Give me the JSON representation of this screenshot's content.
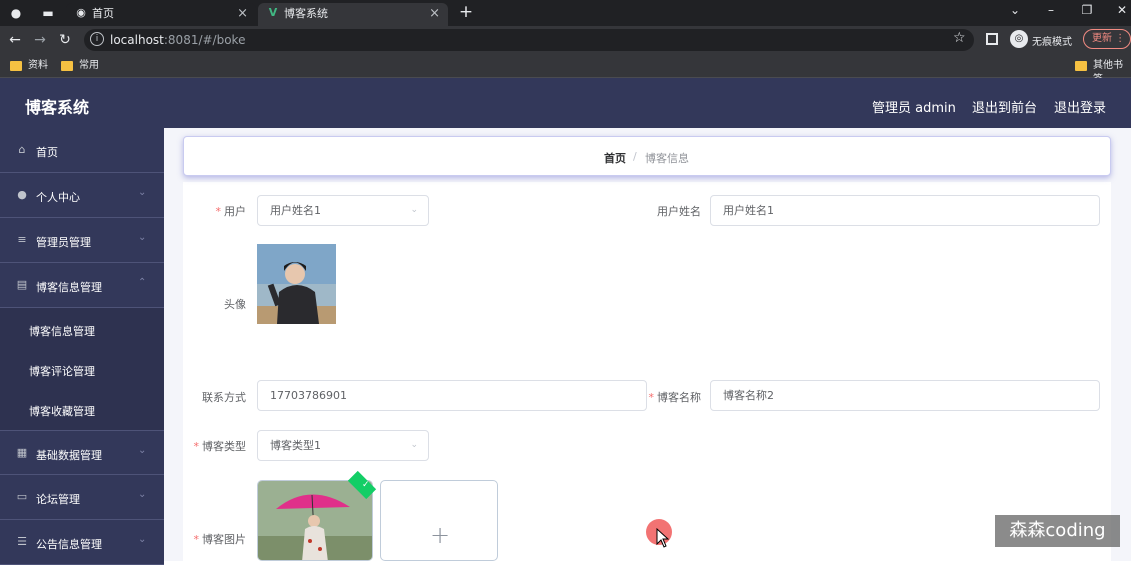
{
  "browser": {
    "tabs": [
      {
        "label": "首页",
        "close": "×"
      },
      {
        "label": "博客系统",
        "close": "×"
      }
    ],
    "new_tab": "+",
    "url_host": "localhost",
    "url_rest": ":8081/#/boke",
    "incognito_label": "无痕模式",
    "update_label": "更新",
    "bookmarks": [
      "资料",
      "常用"
    ],
    "other_bookmarks": "其他书签"
  },
  "header": {
    "title": "博客系统",
    "admin_label": "管理员 admin",
    "to_front_label": "退出到前台",
    "logout_label": "退出登录"
  },
  "sidebar": {
    "items": [
      {
        "label": "首页",
        "icon": "home-icon"
      },
      {
        "label": "个人中心",
        "icon": "user-icon"
      },
      {
        "label": "管理员管理",
        "icon": "sliders-icon"
      },
      {
        "label": "博客信息管理",
        "icon": "clipboard-icon"
      },
      {
        "label": "基础数据管理",
        "icon": "grid-icon"
      },
      {
        "label": "论坛管理",
        "icon": "chat-icon"
      },
      {
        "label": "公告信息管理",
        "icon": "list-icon"
      }
    ],
    "sub_items": [
      "博客信息管理",
      "博客评论管理",
      "博客收藏管理"
    ]
  },
  "breadcrumb": {
    "home": "首页",
    "separator": "/",
    "current": "博客信息"
  },
  "form": {
    "user_label": "用户",
    "user_value": "用户姓名1",
    "user_name_label": "用户姓名",
    "user_name_value": "用户姓名1",
    "avatar_label": "头像",
    "contact_label": "联系方式",
    "contact_value": "17703786901",
    "blog_name_label": "博客名称",
    "blog_name_value": "博客名称2",
    "blog_type_label": "博客类型",
    "blog_type_value": "博客类型1",
    "blog_image_label": "博客图片",
    "upload_plus": "+"
  },
  "watermark": "森森coding",
  "colors": {
    "header_bg": "#33385a",
    "sidebar_bg": "#2e3250",
    "required": "#f56c6c",
    "upload_success": "#13ce66"
  }
}
